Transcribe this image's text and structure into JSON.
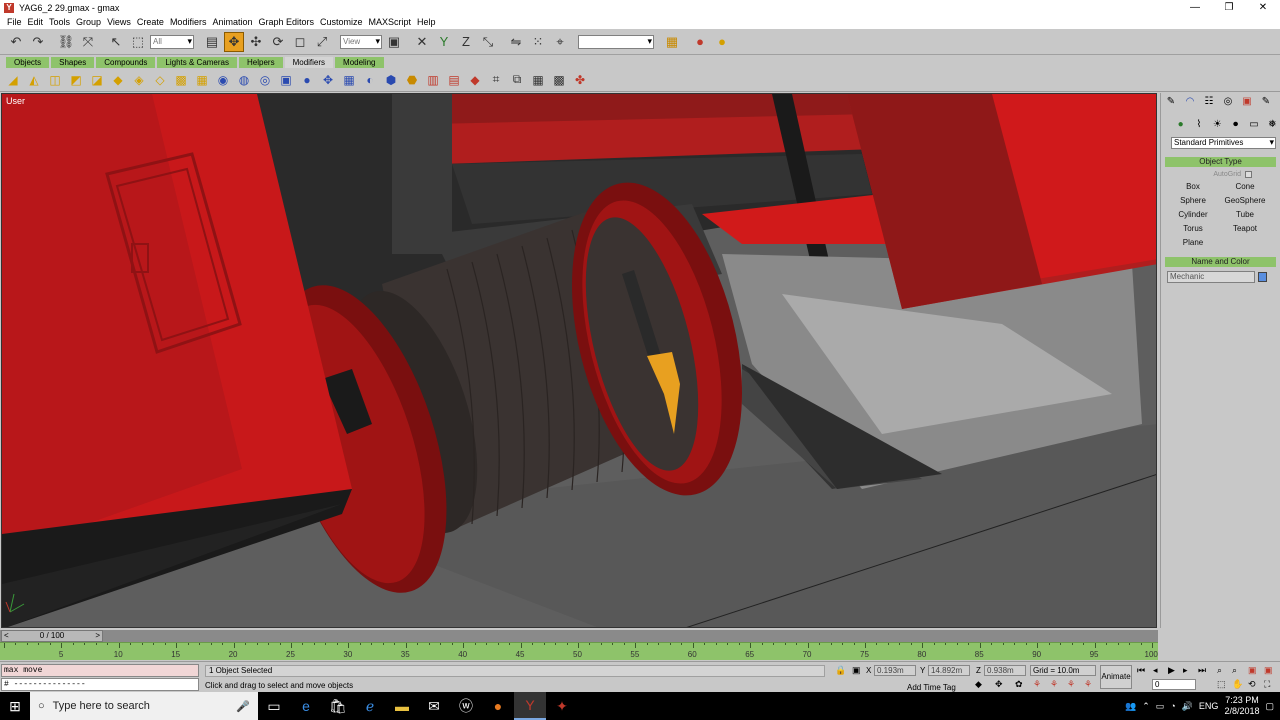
{
  "window": {
    "title": "YAG6_2 29.gmax - gmax",
    "minimize": "—",
    "restore": "❐",
    "close": "✕"
  },
  "menu": [
    "File",
    "Edit",
    "Tools",
    "Group",
    "Views",
    "Create",
    "Modifiers",
    "Animation",
    "Graph Editors",
    "Customize",
    "MAXScript",
    "Help"
  ],
  "toolbar": {
    "selection_filter": "All",
    "ref_coord": "View",
    "named_sel": ""
  },
  "tabs": [
    "Objects",
    "Shapes",
    "Compounds",
    "Lights & Cameras",
    "Helpers",
    "Modifiers",
    "Modeling"
  ],
  "active_tab": "Modifiers",
  "viewport": {
    "label": "User"
  },
  "command_panel": {
    "dropdown": "Standard Primitives",
    "object_type_header": "Object Type",
    "autogrid": "AutoGrid",
    "primitives": [
      "Box",
      "Cone",
      "Sphere",
      "GeoSphere",
      "Cylinder",
      "Tube",
      "Torus",
      "Teapot",
      "Plane"
    ],
    "name_color_header": "Name and Color",
    "name_value": "Mechanic",
    "swatch_color": "#5a8fe0"
  },
  "timeline": {
    "frame_label": "0 / 100",
    "left_arrow": "<",
    "right_arrow": ">",
    "ticks": [
      "5",
      "10",
      "15",
      "20",
      "25",
      "30",
      "35",
      "40",
      "45",
      "50",
      "55",
      "60",
      "65",
      "70",
      "75",
      "80",
      "85",
      "90",
      "95",
      "100"
    ]
  },
  "status": {
    "maxscript_line1": "max move",
    "maxscript_line2": "# ---------------",
    "selection": "1 Object Selected",
    "prompt": "Click and drag to select and move objects",
    "x_label": "X",
    "x_value": "0.193m",
    "y_label": "Y",
    "y_value": "14.892m",
    "z_label": "Z",
    "z_value": "0.938m",
    "grid": "Grid = 10.0m",
    "add_time_tag": "Add Time Tag",
    "animate": "Animate",
    "frame": "0"
  },
  "taskbar": {
    "search_placeholder": "Type here to search",
    "language": "ENG",
    "time": "7:23 PM",
    "date": "2/8/2018"
  }
}
